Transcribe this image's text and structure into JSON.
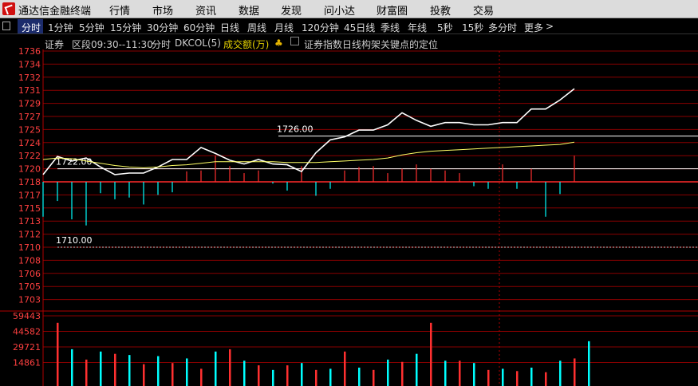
{
  "app": {
    "title": "通达信金融终端"
  },
  "menu": [
    "行情",
    "市场",
    "资讯",
    "数据",
    "发现",
    "问小达",
    "财富圈",
    "投教",
    "交易"
  ],
  "periods": [
    "分时",
    "1分钟",
    "5分钟",
    "15分钟",
    "30分钟",
    "60分钟",
    "日线",
    "周线",
    "月线",
    "120分钟",
    "45日线",
    "季线",
    "年线",
    "5秒",
    "15秒",
    "多分时",
    "更多"
  ],
  "active_period": "分时",
  "more_arrow": ">",
  "info": {
    "name": "证券",
    "session": "区段09:30--11:30",
    "mode": "分时",
    "indicator": "DKCOL(5)",
    "volume_label": "成交额(万)",
    "arrow": "♣",
    "checkbox_label": "证券指数日线构架关键点的定位"
  },
  "colors": {
    "up": "#ff3030",
    "down": "#00ffff",
    "price": "#ffffff",
    "avg": "#ffff66",
    "axis": "#ff4040"
  },
  "price_axis": {
    "ticks": [
      "1736",
      "1734",
      "1732",
      "1731",
      "1729",
      "1727",
      "1725",
      "1724",
      "1722",
      "1720",
      "1718",
      "1717",
      "1715",
      "1713",
      "1712",
      "1710",
      "1708",
      "1706",
      "1705",
      "1703"
    ],
    "base_index": 10
  },
  "volume_axis": {
    "ticks": [
      "59443",
      "44582",
      "29721",
      "14861"
    ],
    "max": 74304
  },
  "annotations": [
    {
      "label": "1726.00",
      "tick_index": 6.5
    },
    {
      "label": "1722.00",
      "tick_index": 9
    },
    {
      "label": "1710.00",
      "tick_index": 15
    }
  ],
  "chart_data": {
    "type": "line",
    "price_line": [
      1719.6,
      1722.0,
      1721.4,
      1721.8,
      1720.6,
      1719.6,
      1719.8,
      1719.8,
      1720.6,
      1721.6,
      1721.6,
      1723.2,
      1722.4,
      1721.5,
      1721.0,
      1721.6,
      1721.0,
      1720.9,
      1720.0,
      1722.5,
      1724.2,
      1724.6,
      1725.5,
      1725.5,
      1726.2,
      1727.8,
      1726.8,
      1726.0,
      1726.5,
      1726.5,
      1726.2,
      1726.2,
      1726.5,
      1726.5,
      1728.3,
      1728.3,
      1729.5,
      1731.0
    ],
    "avg_line": [
      1721.6,
      1721.8,
      1721.7,
      1721.4,
      1721.1,
      1720.8,
      1720.6,
      1720.5,
      1720.6,
      1720.8,
      1720.9,
      1721.1,
      1721.3,
      1721.3,
      1721.3,
      1721.3,
      1721.3,
      1721.2,
      1721.2,
      1721.2,
      1721.3,
      1721.4,
      1721.5,
      1721.6,
      1721.8,
      1722.2,
      1722.5,
      1722.7,
      1722.8,
      1722.9,
      1723.0,
      1723.1,
      1723.2,
      1723.3,
      1723.4,
      1723.5,
      1723.6,
      1723.9
    ],
    "dkcol_bars": [
      -4.0,
      -2.2,
      -4.3,
      -5.0,
      -1.3,
      -2.0,
      -1.8,
      -2.6,
      -1.5,
      -1.2,
      1.2,
      1.3,
      3.0,
      1.8,
      1.0,
      1.3,
      -0.2,
      -1.0,
      1.8,
      -1.6,
      -0.8,
      1.3,
      1.7,
      1.8,
      1.0,
      1.5,
      2.0,
      1.5,
      1.3,
      1.0,
      -0.5,
      -0.8,
      2.0,
      -0.8,
      1.5,
      -4.0,
      -1.4,
      3.0
    ],
    "volume": [
      55000,
      32000,
      23000,
      30000,
      28000,
      27000,
      19000,
      26000,
      20000,
      24000,
      15000,
      30000,
      32000,
      22000,
      18000,
      14000,
      18000,
      20000,
      14000,
      15000,
      30000,
      16000,
      14000,
      23000,
      21000,
      28000,
      55000,
      22000,
      22000,
      20000,
      14000,
      15000,
      13000,
      16000,
      12000,
      22000,
      24000,
      39000
    ]
  }
}
